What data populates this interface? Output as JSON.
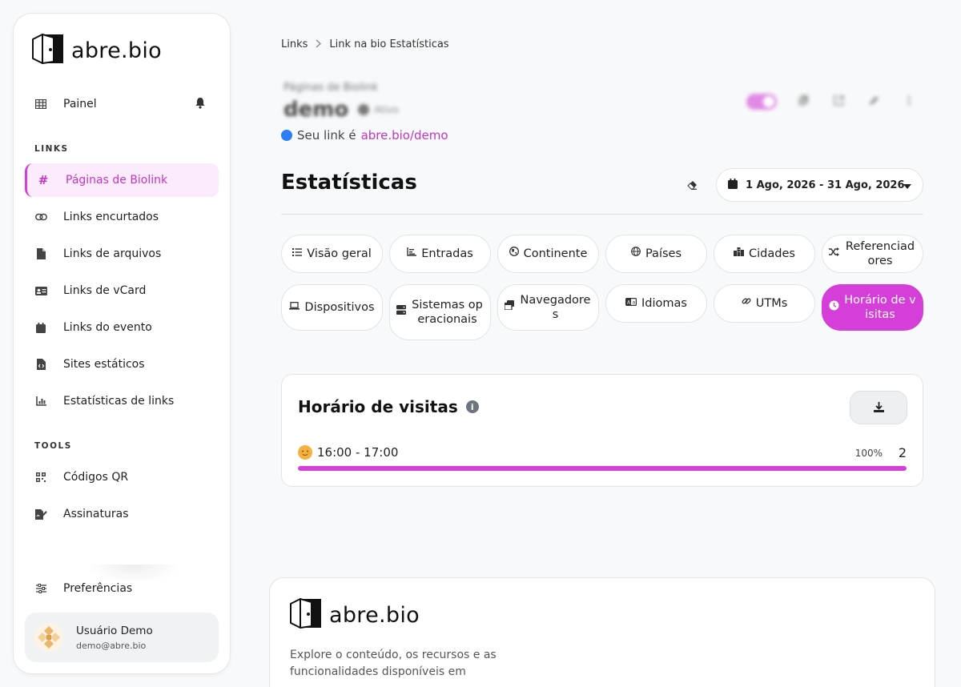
{
  "brand": {
    "name": "abre.bio",
    "accent": "#d63ed9"
  },
  "sidebar": {
    "dashboard_label": "Painel",
    "section_links": "LINKS",
    "section_tools": "TOOLS",
    "links": [
      {
        "label": "Páginas de Biolink",
        "icon": "hash-icon"
      },
      {
        "label": "Links encurtados",
        "icon": "link-icon"
      },
      {
        "label": "Links de arquivos",
        "icon": "file-icon"
      },
      {
        "label": "Links de vCard",
        "icon": "id-card-icon"
      },
      {
        "label": "Links do evento",
        "icon": "calendar-icon"
      },
      {
        "label": "Sites estáticos",
        "icon": "code-file-icon"
      },
      {
        "label": "Estatísticas de links",
        "icon": "chart-icon"
      }
    ],
    "tools": [
      {
        "label": "Códigos QR",
        "icon": "qr-icon"
      },
      {
        "label": "Assinaturas",
        "icon": "signature-icon"
      }
    ],
    "preferences_label": "Preferências",
    "user": {
      "name": "Usuário Demo",
      "email": "demo@abre.bio"
    }
  },
  "breadcrumb": {
    "root": "Links",
    "current": "Link na bio Estatísticas"
  },
  "page_header": {
    "subtitle": "Páginas de Biolink",
    "title": "demo",
    "status": "Ativo",
    "link_prefix": "Seu link é",
    "link_url": "abre.bio/demo"
  },
  "stats": {
    "title": "Estatísticas",
    "date_range": "1 Ago, 2026 - 31 Ago, 2026"
  },
  "tabs": [
    {
      "label": "Visão geral",
      "icon": "list-icon"
    },
    {
      "label": "Entradas",
      "icon": "bar-chart-icon"
    },
    {
      "label": "Continente",
      "icon": "globe-americas-icon"
    },
    {
      "label": "Países",
      "icon": "globe-icon"
    },
    {
      "label": "Cidades",
      "icon": "city-icon"
    },
    {
      "label": "Referenciadores",
      "icon": "shuffle-icon"
    },
    {
      "label": "Dispositivos",
      "icon": "laptop-icon"
    },
    {
      "label": "Sistemas operacionais",
      "icon": "server-icon"
    },
    {
      "label": "Navegadores",
      "icon": "windows-icon"
    },
    {
      "label": "Idiomas",
      "icon": "language-icon"
    },
    {
      "label": "UTMs",
      "icon": "link-icon"
    },
    {
      "label": "Horário de visitas",
      "icon": "clock-icon"
    }
  ],
  "visits_card": {
    "title": "Horário de visitas",
    "rows": [
      {
        "label": "16:00 - 17:00",
        "percent": "100%",
        "count": "2",
        "fraction": 1.0
      }
    ]
  },
  "footer": {
    "text": "Explore o conteúdo, os recursos e as funcionalidades disponíveis em"
  }
}
